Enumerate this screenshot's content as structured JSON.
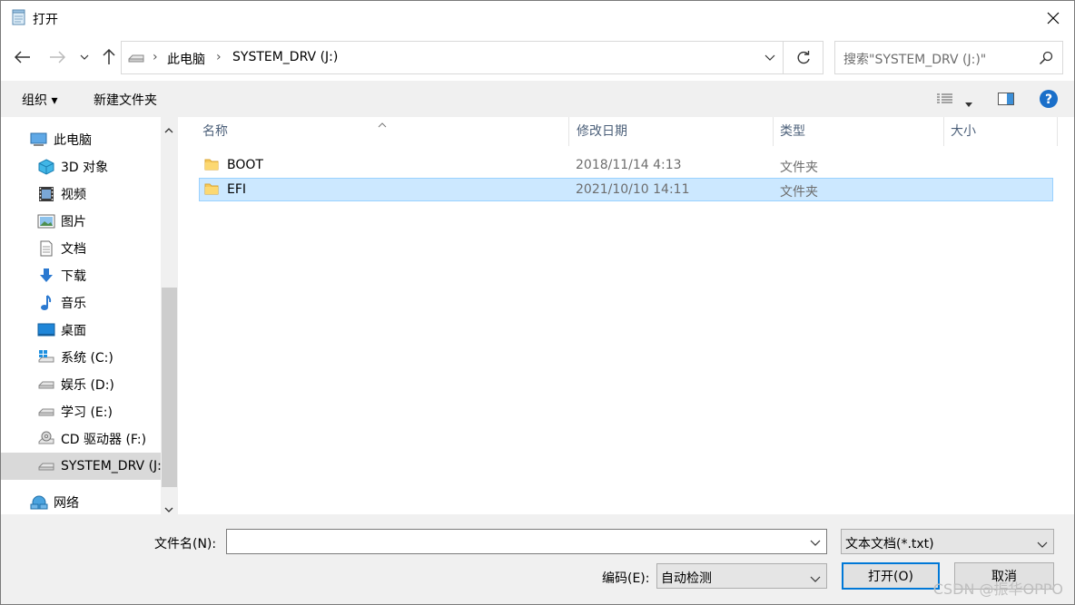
{
  "window": {
    "title": "打开"
  },
  "nav": {
    "address": {
      "breadcrumb": [
        "此电脑",
        "SYSTEM_DRV (J:)"
      ]
    },
    "search": {
      "placeholder": "搜索\"SYSTEM_DRV (J:)\""
    }
  },
  "toolbar": {
    "organize": "组织 ▾",
    "new_folder": "新建文件夹"
  },
  "sidebar": {
    "items": [
      {
        "label": "此电脑",
        "icon": "computer-icon"
      },
      {
        "label": "3D 对象",
        "icon": "3d-objects-icon"
      },
      {
        "label": "视频",
        "icon": "video-icon"
      },
      {
        "label": "图片",
        "icon": "pictures-icon"
      },
      {
        "label": "文档",
        "icon": "documents-icon"
      },
      {
        "label": "下载",
        "icon": "download-icon"
      },
      {
        "label": "音乐",
        "icon": "music-icon"
      },
      {
        "label": "桌面",
        "icon": "desktop-icon"
      },
      {
        "label": "系统 (C:)",
        "icon": "windows-drive-icon"
      },
      {
        "label": "娱乐 (D:)",
        "icon": "drive-icon"
      },
      {
        "label": "学习 (E:)",
        "icon": "drive-icon"
      },
      {
        "label": "CD 驱动器 (F:)",
        "icon": "cd-drive-icon"
      },
      {
        "label": "SYSTEM_DRV (J:)",
        "icon": "drive-icon"
      },
      {
        "label": "网络",
        "icon": "network-icon"
      }
    ]
  },
  "filelist": {
    "columns": [
      "名称",
      "修改日期",
      "类型",
      "大小"
    ],
    "rows": [
      {
        "name": "BOOT",
        "modified": "2018/11/14 4:13",
        "type": "文件夹",
        "size": ""
      },
      {
        "name": "EFI",
        "modified": "2021/10/10 14:11",
        "type": "文件夹",
        "size": ""
      }
    ]
  },
  "footer": {
    "filename_label": "文件名(N):",
    "filename_value": "",
    "filetype_value": "文本文档(*.txt)",
    "encoding_label": "编码(E):",
    "encoding_value": "自动检测",
    "open_button": "打开(O)",
    "cancel_button": "取消"
  },
  "watermark": "CSDN @振华OPPO",
  "colors": {
    "accent": "#0078d7",
    "selected_row": "#cce8ff",
    "chrome": "#f0f0f0",
    "help": "#1a6fc9"
  }
}
